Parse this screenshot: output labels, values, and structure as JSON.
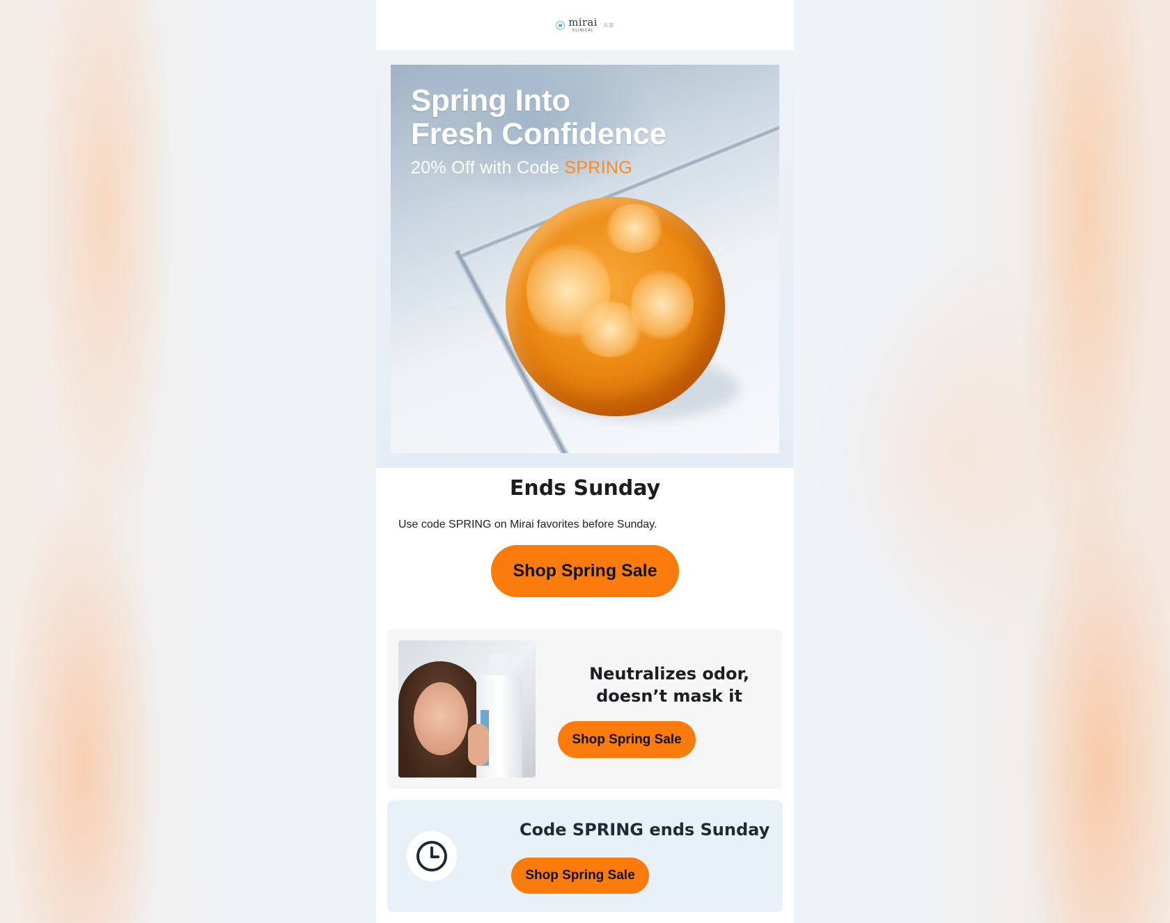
{
  "logo": {
    "word": "mirai",
    "sub": "CLINICAL",
    "jp": "未来"
  },
  "hero": {
    "headline_line1": "Spring Into",
    "headline_line2": "Fresh Confidence",
    "sub_prefix": "20% Off with Code ",
    "code": "SPRING",
    "accent_color": "#ff8a1e"
  },
  "ends": {
    "title": "Ends Sunday",
    "copy": "Use code SPRING on Mirai favorites before Sunday.",
    "cta": "Shop Spring Sale"
  },
  "card1": {
    "title_line1": "Neutralizes odor,",
    "title_line2": "doesn’t mask it",
    "cta": "Shop Spring Sale"
  },
  "card2": {
    "icon": "clock-icon",
    "title": "Code SPRING ends Sunday",
    "cta": "Shop Spring Sale"
  },
  "colors": {
    "cta": "#fb7c0c",
    "card1_bg": "#f6f6f6",
    "card2_bg": "#e9f1f8"
  }
}
